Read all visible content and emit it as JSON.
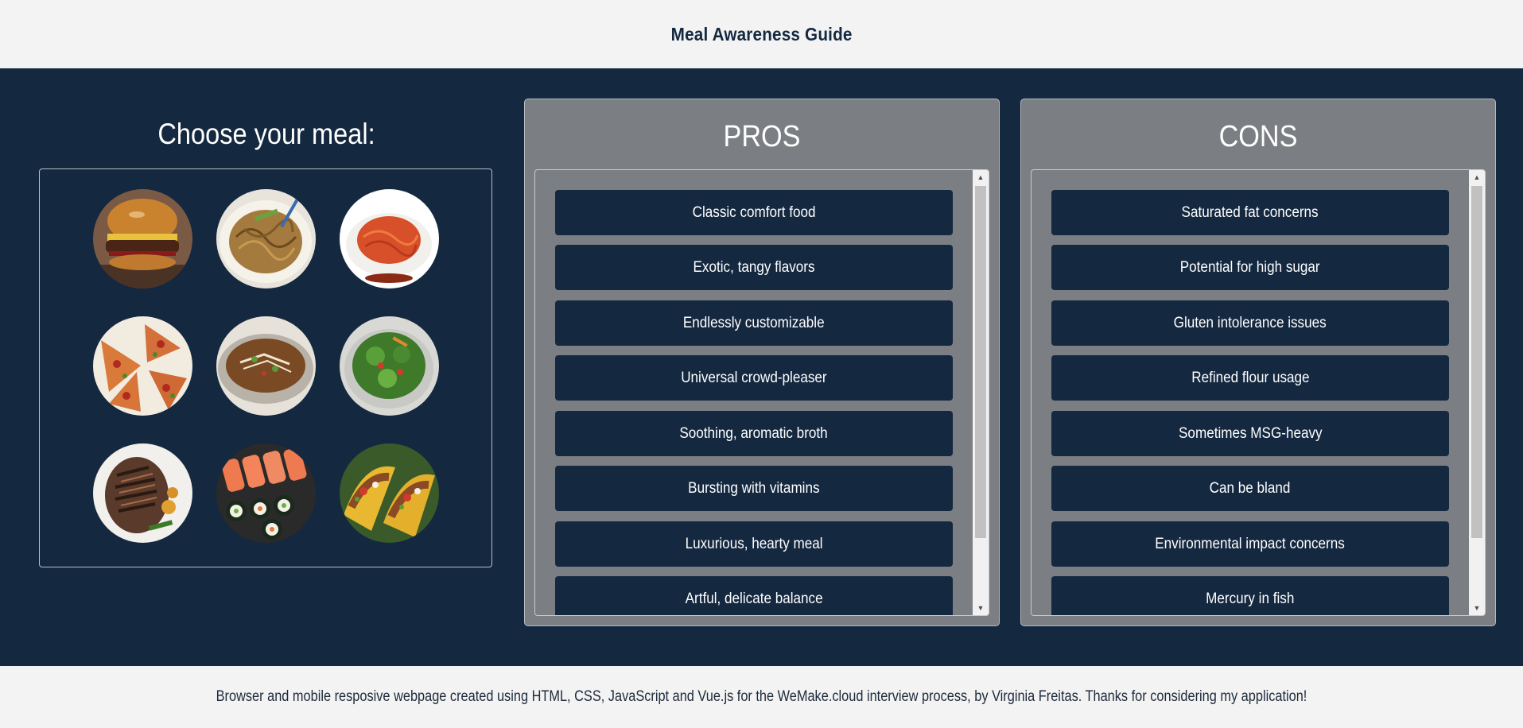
{
  "header": {
    "title": "Meal Awareness Guide"
  },
  "chooser": {
    "heading": "Choose your meal:",
    "meals": [
      "burger-image",
      "noodles-image",
      "spaghetti-image",
      "pizza-image",
      "pho-image",
      "salad-image",
      "steak-image",
      "sushi-image",
      "tacos-image"
    ]
  },
  "pros": {
    "heading": "PROS",
    "items": [
      "Classic comfort food",
      "Exotic, tangy flavors",
      "Endlessly customizable",
      "Universal crowd-pleaser",
      "Soothing, aromatic broth",
      "Bursting with vitamins",
      "Luxurious, hearty meal",
      "Artful, delicate balance"
    ]
  },
  "cons": {
    "heading": "CONS",
    "items": [
      "Saturated fat concerns",
      "Potential for high sugar",
      "Gluten intolerance issues",
      "Refined flour usage",
      "Sometimes MSG-heavy",
      "Can be bland",
      "Environmental impact concerns",
      "Mercury in fish"
    ]
  },
  "scrollbar": {
    "up_arrow": "▲",
    "down_arrow": "▼"
  },
  "footer": {
    "text": "Browser and mobile resposive webpage created using HTML, CSS, JavaScript and Vue.js for the WeMake.cloud interview process, by Virginia Freitas. Thanks for considering my application!"
  },
  "colors": {
    "navy": "#142840",
    "panel_gray": "#7b7e82",
    "light_bg": "#f3f3f3"
  }
}
